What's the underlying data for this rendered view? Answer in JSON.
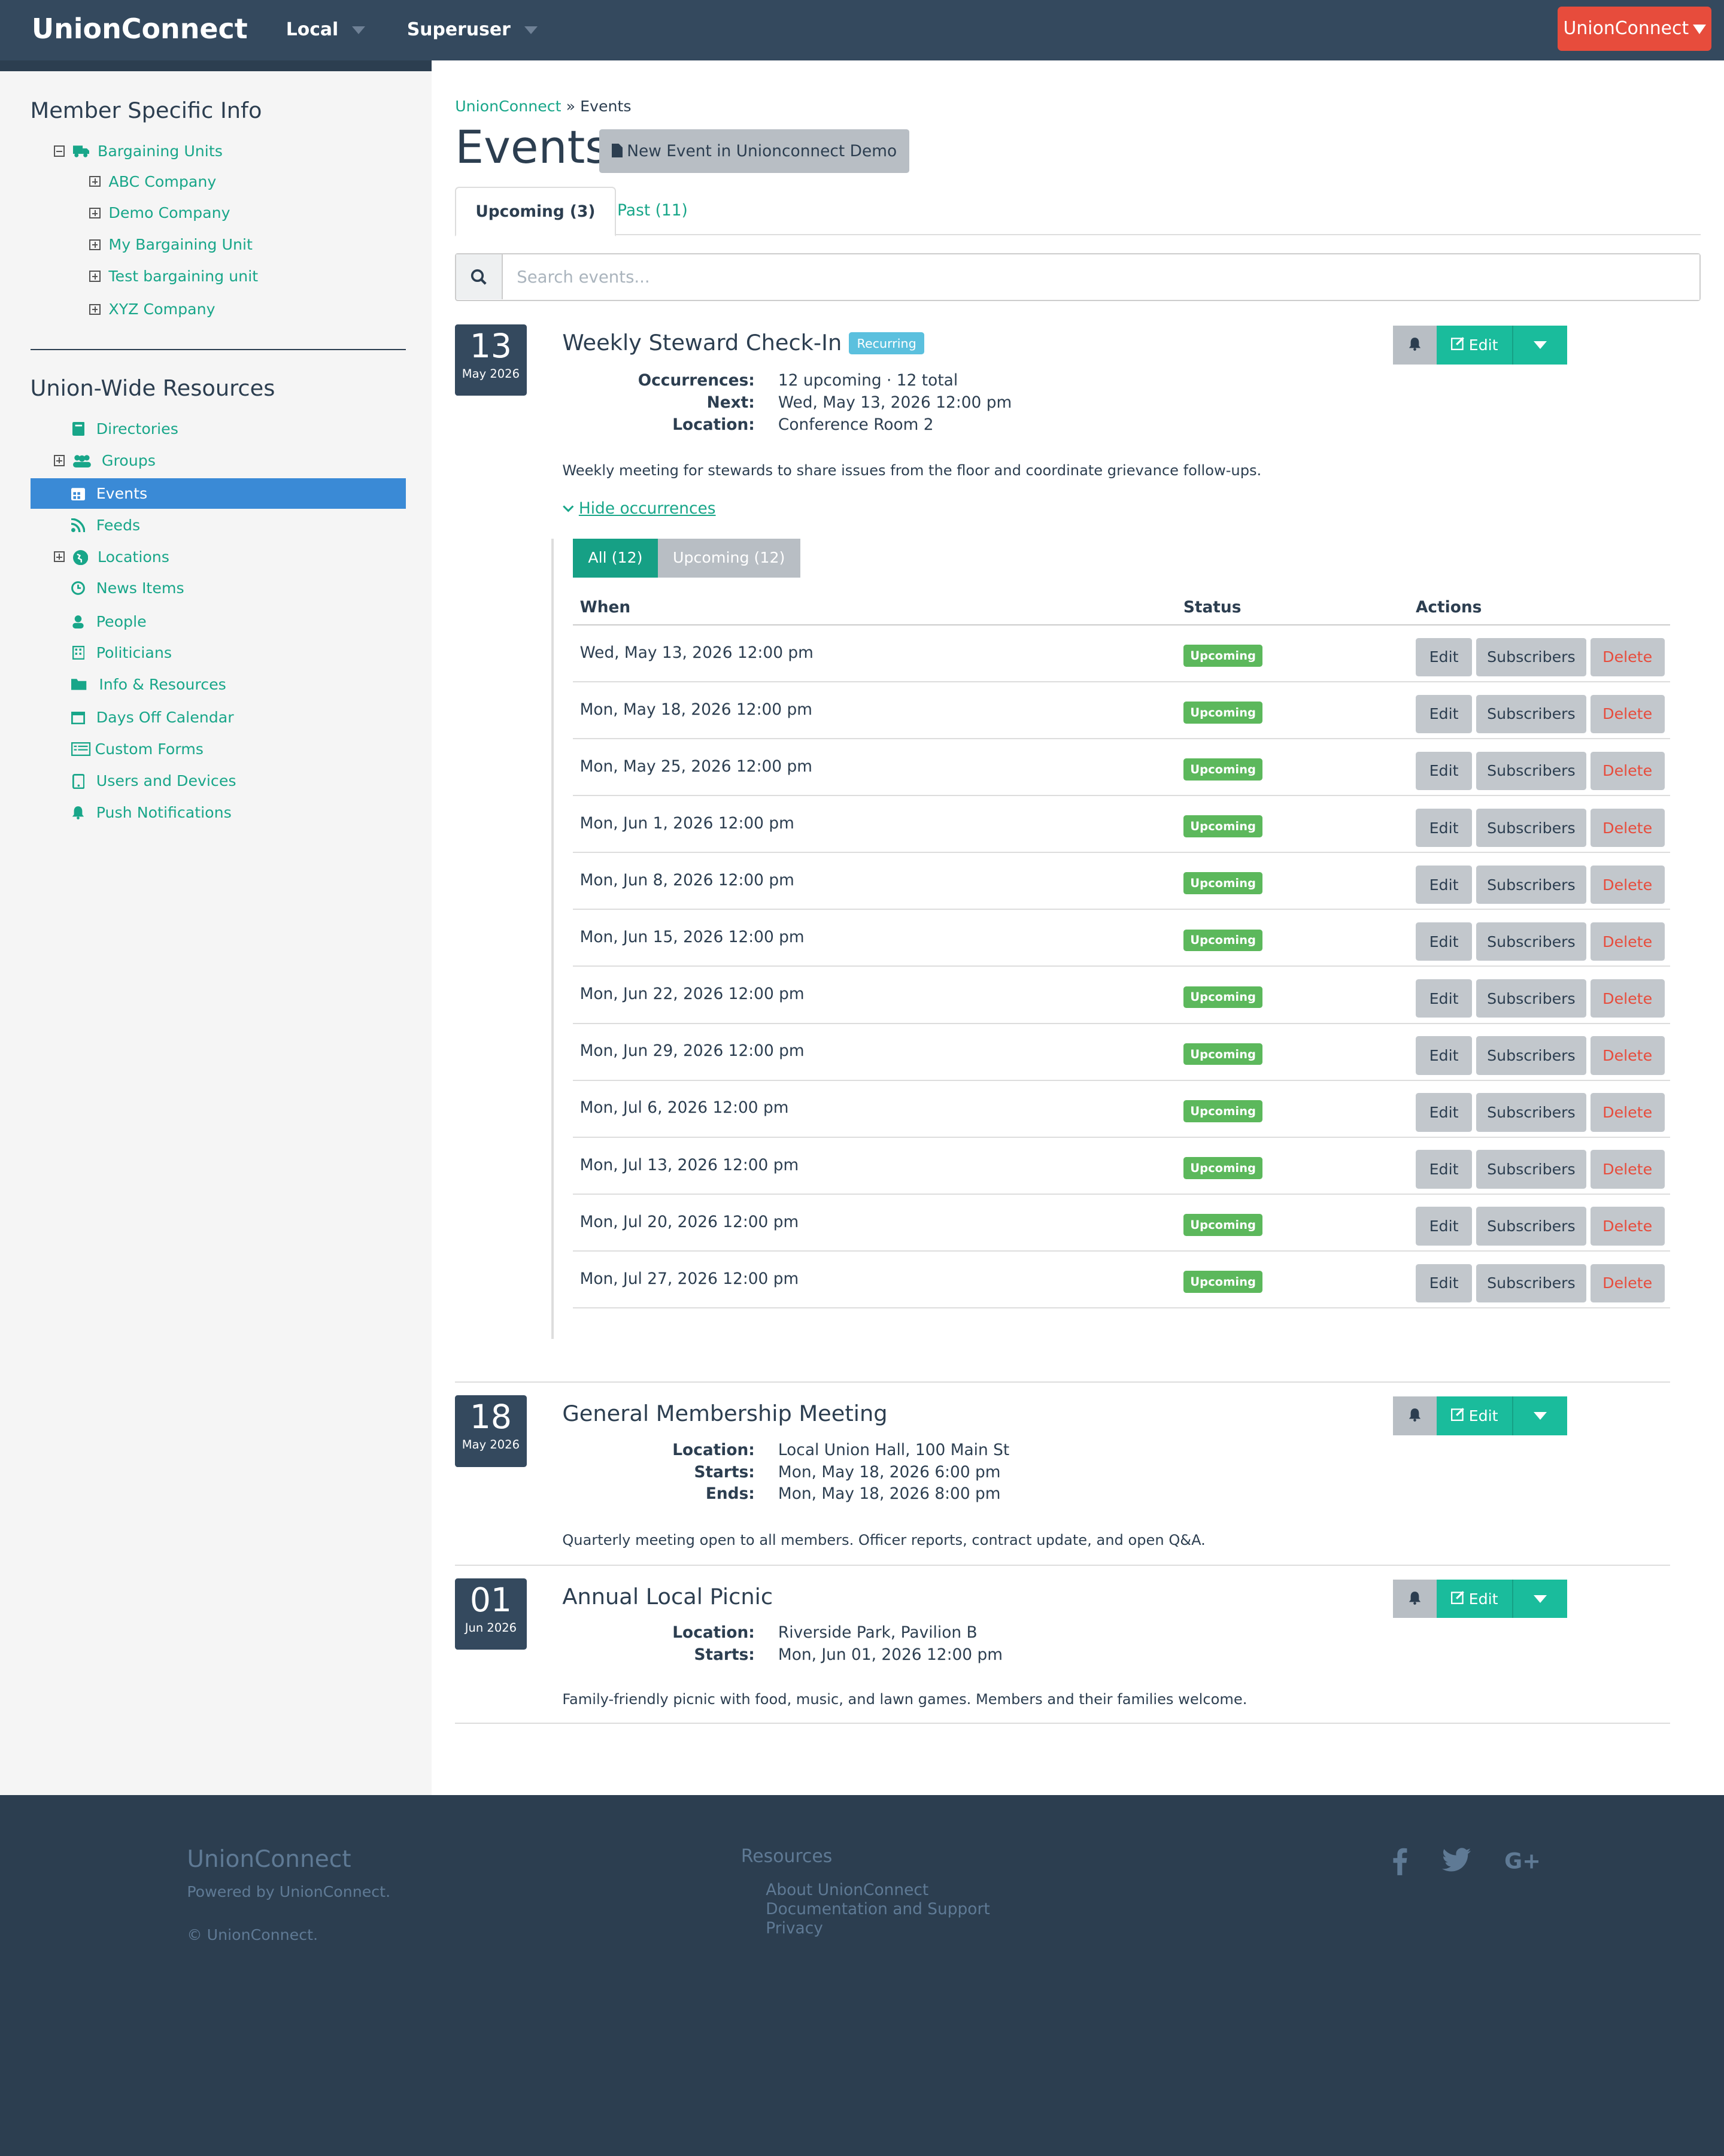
{
  "navbar": {
    "brand": "UnionConnect",
    "menus": [
      {
        "label": "Local"
      },
      {
        "label": "Superuser"
      }
    ],
    "account_button": "UnionConnect"
  },
  "sidebar": {
    "member_heading": "Member Specific Info",
    "bargaining_units": {
      "label": "Bargaining Units",
      "children": [
        "ABC Company",
        "Demo Company",
        "My Bargaining Unit",
        "Test bargaining unit",
        "XYZ Company"
      ]
    },
    "union_heading": "Union-Wide Resources",
    "resources": [
      {
        "label": "Directories",
        "icon": "book-icon",
        "expandable": false
      },
      {
        "label": "Groups",
        "icon": "users-icon",
        "expandable": true
      },
      {
        "label": "Events",
        "icon": "calendar-icon",
        "expandable": false,
        "active": true
      },
      {
        "label": "Feeds",
        "icon": "rss-icon",
        "expandable": false
      },
      {
        "label": "Locations",
        "icon": "globe-icon",
        "expandable": true
      },
      {
        "label": "News Items",
        "icon": "clock-icon",
        "expandable": false
      },
      {
        "label": "People",
        "icon": "user-icon",
        "expandable": false
      },
      {
        "label": "Politicians",
        "icon": "building-icon",
        "expandable": false
      },
      {
        "label": "Info & Resources",
        "icon": "folder-icon",
        "expandable": false
      },
      {
        "label": "Days Off Calendar",
        "icon": "calendar-outline-icon",
        "expandable": false
      },
      {
        "label": "Custom Forms",
        "icon": "list-icon",
        "expandable": false
      },
      {
        "label": "Users and Devices",
        "icon": "tablet-icon",
        "expandable": false
      },
      {
        "label": "Push Notifications",
        "icon": "bell-icon",
        "expandable": false
      }
    ]
  },
  "breadcrumb": {
    "root": "UnionConnect",
    "sep": "»",
    "current": "Events"
  },
  "page": {
    "title": "Events",
    "new_button": "New Event in Unionconnect Demo",
    "tabs": [
      {
        "label": "Upcoming (3)",
        "active": true
      },
      {
        "label": "Past (11)",
        "active": false
      }
    ],
    "search_placeholder": "Search events..."
  },
  "events": [
    {
      "day": "13",
      "month": "May 2026",
      "title": "Weekly Steward Check-In",
      "badge": "Recurring",
      "meta": [
        {
          "k": "Occurrences:",
          "v": "12 upcoming · 12 total"
        },
        {
          "k": "Next:",
          "v": "Wed, May 13, 2026 12:00 pm"
        },
        {
          "k": "Location:",
          "v": "Conference Room 2"
        }
      ],
      "description": "Weekly meeting for stewards to share issues from the floor and coordinate grievance follow-ups.",
      "toggle": "Hide occurrences",
      "occurrence_tabs": [
        "All (12)",
        "Upcoming (12)"
      ],
      "occurrence_headers": {
        "when": "When",
        "status": "Status",
        "actions": "Actions"
      },
      "occurrences": [
        {
          "when": "Wed, May 13, 2026 12:00 pm",
          "status": "Upcoming"
        },
        {
          "when": "Mon, May 18, 2026 12:00 pm",
          "status": "Upcoming"
        },
        {
          "when": "Mon, May 25, 2026 12:00 pm",
          "status": "Upcoming"
        },
        {
          "when": "Mon, Jun 1, 2026 12:00 pm",
          "status": "Upcoming"
        },
        {
          "when": "Mon, Jun 8, 2026 12:00 pm",
          "status": "Upcoming"
        },
        {
          "when": "Mon, Jun 15, 2026 12:00 pm",
          "status": "Upcoming"
        },
        {
          "when": "Mon, Jun 22, 2026 12:00 pm",
          "status": "Upcoming"
        },
        {
          "when": "Mon, Jun 29, 2026 12:00 pm",
          "status": "Upcoming"
        },
        {
          "when": "Mon, Jul 6, 2026 12:00 pm",
          "status": "Upcoming"
        },
        {
          "when": "Mon, Jul 13, 2026 12:00 pm",
          "status": "Upcoming"
        },
        {
          "when": "Mon, Jul 20, 2026 12:00 pm",
          "status": "Upcoming"
        },
        {
          "when": "Mon, Jul 27, 2026 12:00 pm",
          "status": "Upcoming"
        }
      ],
      "row_actions": {
        "edit": "Edit",
        "subscribers": "Subscribers",
        "delete": "Delete"
      }
    },
    {
      "day": "18",
      "month": "May 2026",
      "title": "General Membership Meeting",
      "meta": [
        {
          "k": "Location:",
          "v": "Local Union Hall, 100 Main St"
        },
        {
          "k": "Starts:",
          "v": "Mon, May 18, 2026 6:00 pm"
        },
        {
          "k": "Ends:",
          "v": "Mon, May 18, 2026 8:00 pm"
        }
      ],
      "description": "Quarterly meeting open to all members. Officer reports, contract update, and open Q&A."
    },
    {
      "day": "01",
      "month": "Jun 2026",
      "title": "Annual Local Picnic",
      "meta": [
        {
          "k": "Location:",
          "v": "Riverside Park, Pavilion B"
        },
        {
          "k": "Starts:",
          "v": "Mon, Jun 01, 2026 12:00 pm"
        }
      ],
      "description": "Family-friendly picnic with food, music, and lawn games. Members and their families welcome."
    }
  ],
  "event_edit_label": "Edit",
  "footer": {
    "brand": "UnionConnect",
    "powered": "Powered by UnionConnect.",
    "copyright": "© UnionConnect.",
    "resources_heading": "Resources",
    "links": [
      "About UnionConnect",
      "Documentation and Support",
      "Privacy"
    ],
    "social": [
      "facebook-icon",
      "twitter-icon",
      "google-plus-icon"
    ]
  },
  "colors": {
    "navbar": "#34495e",
    "accent": "#1abc9c",
    "link": "#18a689",
    "active_nav": "#3a8ad6",
    "danger": "#e74c3c",
    "success": "#5cb85c",
    "info": "#5bc0de"
  }
}
